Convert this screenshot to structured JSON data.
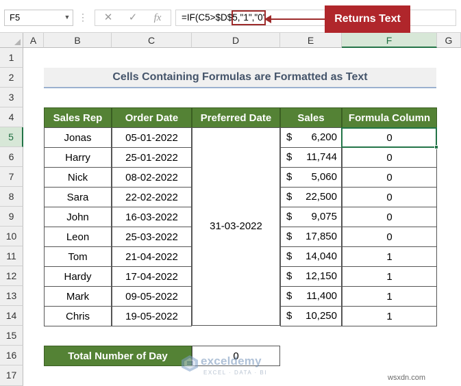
{
  "name_box": "F5",
  "formula": "=IF(C5>$D$5,\"1\",\"0\")",
  "formula_parts": [
    "=IF(C5>$D$5",
    ",\"1\",\"0\""
  ],
  "callout": "Returns Text",
  "toolbar": {
    "cancel_icon": "✕",
    "enter_icon": "✓",
    "fx_label": "fx"
  },
  "columns": [
    "A",
    "B",
    "C",
    "D",
    "E",
    "F",
    "G"
  ],
  "selected_column": "F",
  "rows": [
    "1",
    "2",
    "3",
    "4",
    "5",
    "6",
    "7",
    "8",
    "9",
    "10",
    "11",
    "12",
    "13",
    "14",
    "15",
    "16",
    "17"
  ],
  "selected_row": "5",
  "sheet_title": "Cells Containing Formulas are Formatted as Text",
  "table": {
    "headers": [
      "Sales Rep",
      "Order Date",
      "Preferred Date",
      "Sales",
      "Formula Column"
    ],
    "preferred_date": "31-03-2022",
    "currency_symbol": "$",
    "rows": [
      {
        "rep": "Jonas",
        "order_date": "05-01-2022",
        "sales": "6,200",
        "formula": "0"
      },
      {
        "rep": "Harry",
        "order_date": "25-01-2022",
        "sales": "11,744",
        "formula": "0"
      },
      {
        "rep": "Nick",
        "order_date": "08-02-2022",
        "sales": "5,060",
        "formula": "0"
      },
      {
        "rep": "Sara",
        "order_date": "22-02-2022",
        "sales": "22,500",
        "formula": "0"
      },
      {
        "rep": "John",
        "order_date": "16-03-2022",
        "sales": "9,075",
        "formula": "0"
      },
      {
        "rep": "Leon",
        "order_date": "25-03-2022",
        "sales": "17,850",
        "formula": "0"
      },
      {
        "rep": "Tom",
        "order_date": "21-04-2022",
        "sales": "14,040",
        "formula": "1"
      },
      {
        "rep": "Hardy",
        "order_date": "17-04-2022",
        "sales": "12,150",
        "formula": "1"
      },
      {
        "rep": "Mark",
        "order_date": "09-05-2022",
        "sales": "11,400",
        "formula": "1"
      },
      {
        "rep": "Chris",
        "order_date": "19-05-2022",
        "sales": "10,250",
        "formula": "1"
      }
    ]
  },
  "total": {
    "label": "Total Number of Day",
    "value": "0"
  },
  "watermark": {
    "name": "exceldemy",
    "tagline": "EXCEL · DATA · BI"
  },
  "site": "wsxdn.com",
  "colors": {
    "header_green": "#548235",
    "callout_red": "#b0262b",
    "title_text": "#44546a",
    "selection_green": "#217346"
  }
}
